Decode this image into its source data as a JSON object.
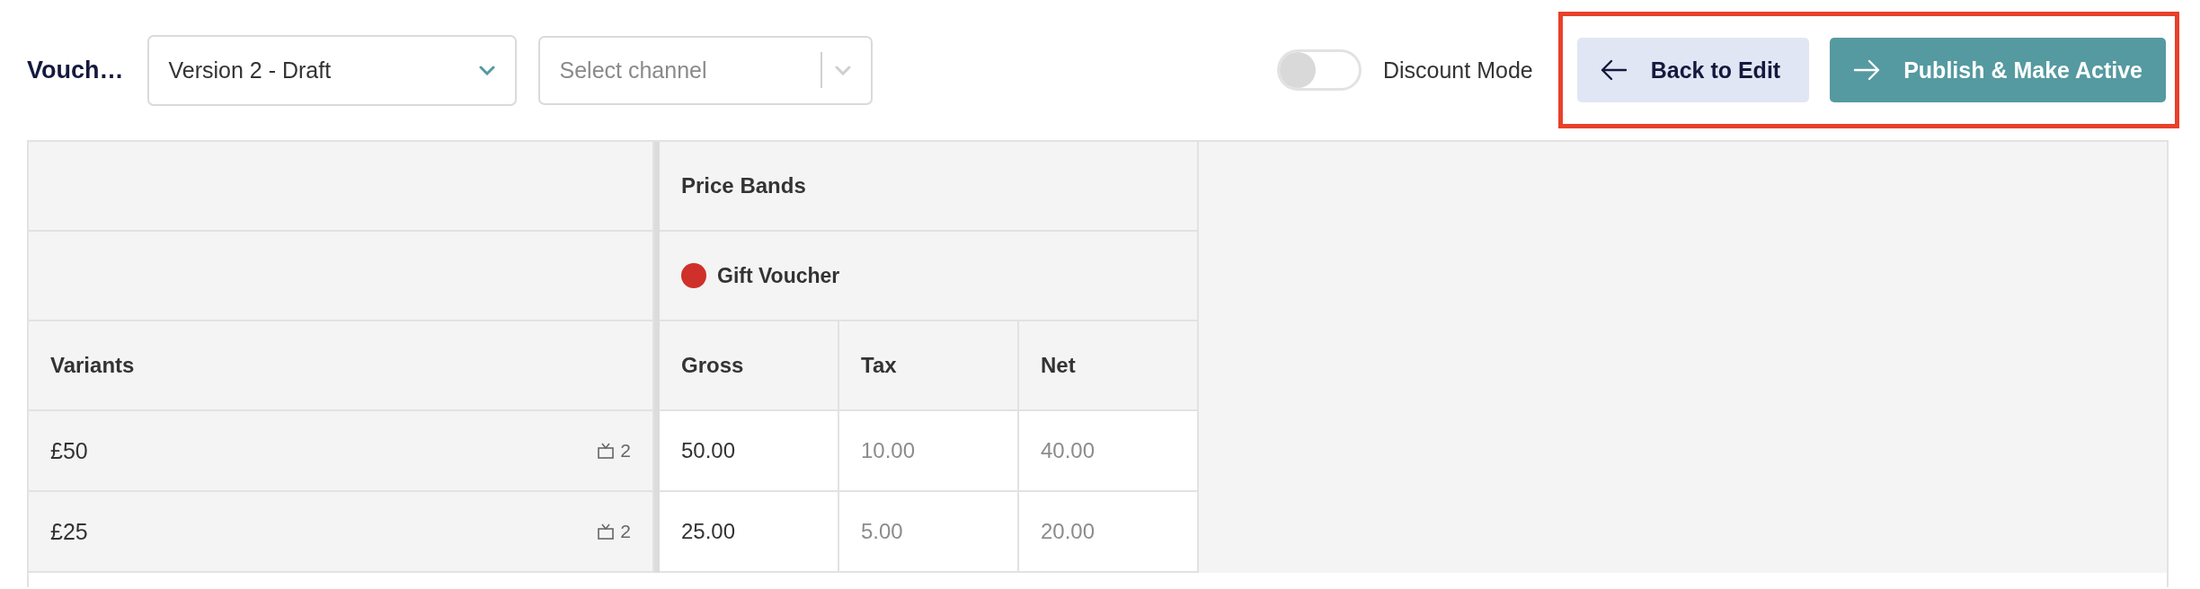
{
  "header": {
    "title": "Vouch…",
    "version_select": {
      "value": "Version 2 - Draft"
    },
    "channel_select": {
      "placeholder": "Select channel"
    },
    "discount_toggle": {
      "label": "Discount Mode",
      "on": false
    },
    "buttons": [
      {
        "label": "Back to Edit",
        "kind": "secondary"
      },
      {
        "label": "Publish & Make Active",
        "kind": "primary"
      }
    ]
  },
  "table": {
    "group_header": "Price Bands",
    "price_band": {
      "name": "Gift Voucher",
      "color": "#cf3029"
    },
    "variants_header": "Variants",
    "columns": [
      "Gross",
      "Tax",
      "Net"
    ],
    "rows": [
      {
        "variant": "£50",
        "channel_count": "2",
        "gross": "50.00",
        "tax": "10.00",
        "net": "40.00"
      },
      {
        "variant": "£25",
        "channel_count": "2",
        "gross": "25.00",
        "tax": "5.00",
        "net": "20.00"
      }
    ]
  }
}
